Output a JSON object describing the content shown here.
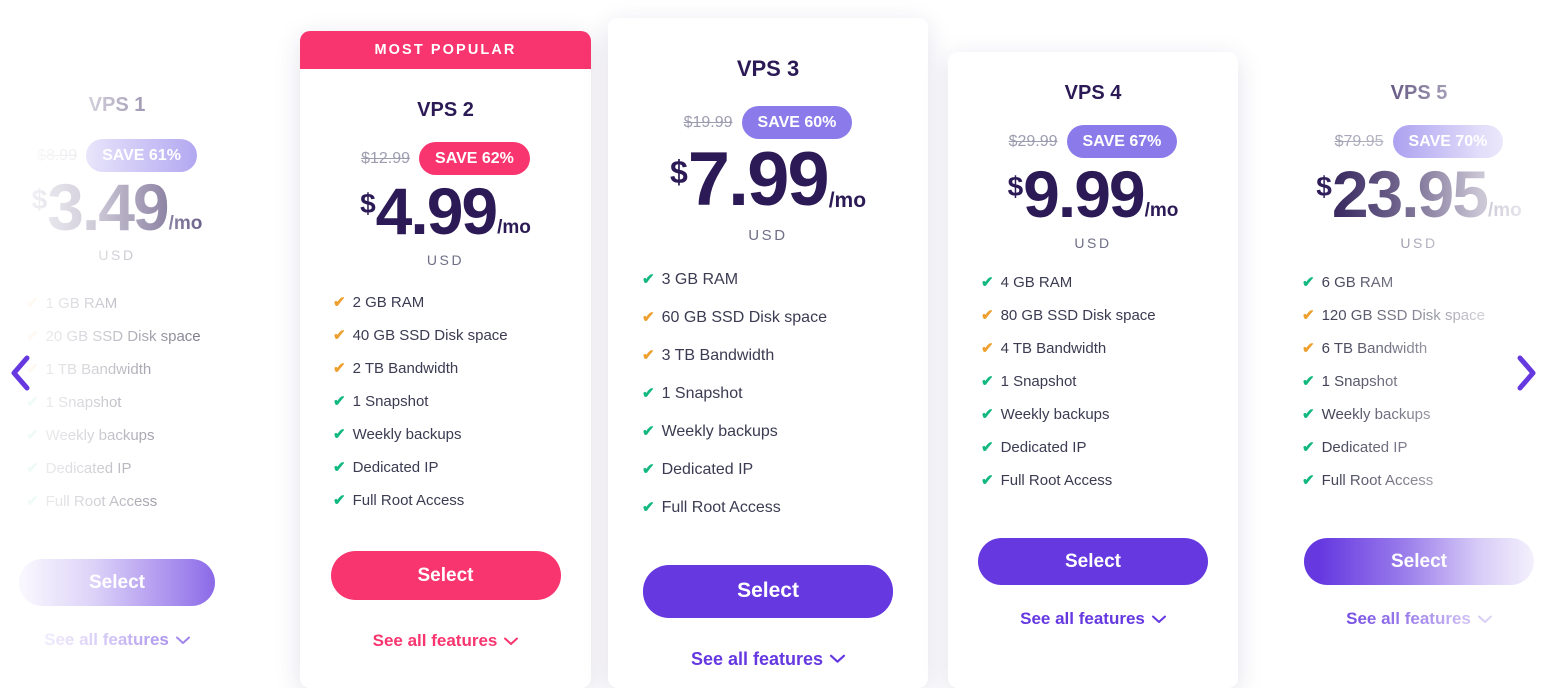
{
  "carousel": {
    "prev_label": "previous",
    "next_label": "next",
    "prev_icon": "chevron-left-icon",
    "next_icon": "chevron-right-icon"
  },
  "labels": {
    "currency_symbol": "$",
    "per_month": "/mo",
    "currency_code": "USD",
    "select": "Select",
    "see_all_features": "See all features",
    "chevron": "⌄",
    "check_glyph": "✔"
  },
  "colors": {
    "purple": "#6538e0",
    "purple_badge": "#8b7bea",
    "pink": "#f8356f",
    "dark_text": "#2b1a55",
    "check_green": "#13b87f",
    "check_orange": "#eda02e",
    "old_price_grey": "#9d9db0"
  },
  "plans": [
    {
      "name": "VPS 1",
      "ribbon": null,
      "old_price": "$8.99",
      "save": "SAVE 61%",
      "save_style": "purple",
      "price_amount": "3.49",
      "features": [
        {
          "text": "1 GB RAM",
          "check": "orange"
        },
        {
          "text": "20 GB SSD Disk space",
          "check": "orange"
        },
        {
          "text": "1 TB Bandwidth",
          "check": "orange"
        },
        {
          "text": "1 Snapshot",
          "check": "green"
        },
        {
          "text": "Weekly backups",
          "check": "green"
        },
        {
          "text": "Dedicated IP",
          "check": "green"
        },
        {
          "text": "Full Root Access",
          "check": "green"
        }
      ],
      "button_style": "purple"
    },
    {
      "name": "VPS 2",
      "ribbon": "MOST POPULAR",
      "old_price": "$12.99",
      "save": "SAVE 62%",
      "save_style": "pink",
      "price_amount": "4.99",
      "features": [
        {
          "text": "2 GB RAM",
          "check": "orange"
        },
        {
          "text": "40 GB SSD Disk space",
          "check": "orange"
        },
        {
          "text": "2 TB Bandwidth",
          "check": "orange"
        },
        {
          "text": "1 Snapshot",
          "check": "green"
        },
        {
          "text": "Weekly backups",
          "check": "green"
        },
        {
          "text": "Dedicated IP",
          "check": "green"
        },
        {
          "text": "Full Root Access",
          "check": "green"
        }
      ],
      "button_style": "pink"
    },
    {
      "name": "VPS 3",
      "ribbon": null,
      "old_price": "$19.99",
      "save": "SAVE 60%",
      "save_style": "purple",
      "price_amount": "7.99",
      "features": [
        {
          "text": "3 GB RAM",
          "check": "green"
        },
        {
          "text": "60 GB SSD Disk space",
          "check": "orange"
        },
        {
          "text": "3 TB Bandwidth",
          "check": "orange"
        },
        {
          "text": "1 Snapshot",
          "check": "green"
        },
        {
          "text": "Weekly backups",
          "check": "green"
        },
        {
          "text": "Dedicated IP",
          "check": "green"
        },
        {
          "text": "Full Root Access",
          "check": "green"
        }
      ],
      "button_style": "purple"
    },
    {
      "name": "VPS 4",
      "ribbon": null,
      "old_price": "$29.99",
      "save": "SAVE 67%",
      "save_style": "purple",
      "price_amount": "9.99",
      "features": [
        {
          "text": "4 GB RAM",
          "check": "green"
        },
        {
          "text": "80 GB SSD Disk space",
          "check": "orange"
        },
        {
          "text": "4 TB Bandwidth",
          "check": "orange"
        },
        {
          "text": "1 Snapshot",
          "check": "green"
        },
        {
          "text": "Weekly backups",
          "check": "green"
        },
        {
          "text": "Dedicated IP",
          "check": "green"
        },
        {
          "text": "Full Root Access",
          "check": "green"
        }
      ],
      "button_style": "purple"
    },
    {
      "name": "VPS 5",
      "ribbon": null,
      "old_price": "$79.95",
      "save": "SAVE 70%",
      "save_style": "purple",
      "price_amount": "23.95",
      "features": [
        {
          "text": "6 GB RAM",
          "check": "green"
        },
        {
          "text": "120 GB SSD Disk space",
          "check": "orange"
        },
        {
          "text": "6 TB Bandwidth",
          "check": "orange"
        },
        {
          "text": "1 Snapshot",
          "check": "green"
        },
        {
          "text": "Weekly backups",
          "check": "green"
        },
        {
          "text": "Dedicated IP",
          "check": "green"
        },
        {
          "text": "Full Root Access",
          "check": "green"
        }
      ],
      "button_style": "purple"
    }
  ]
}
